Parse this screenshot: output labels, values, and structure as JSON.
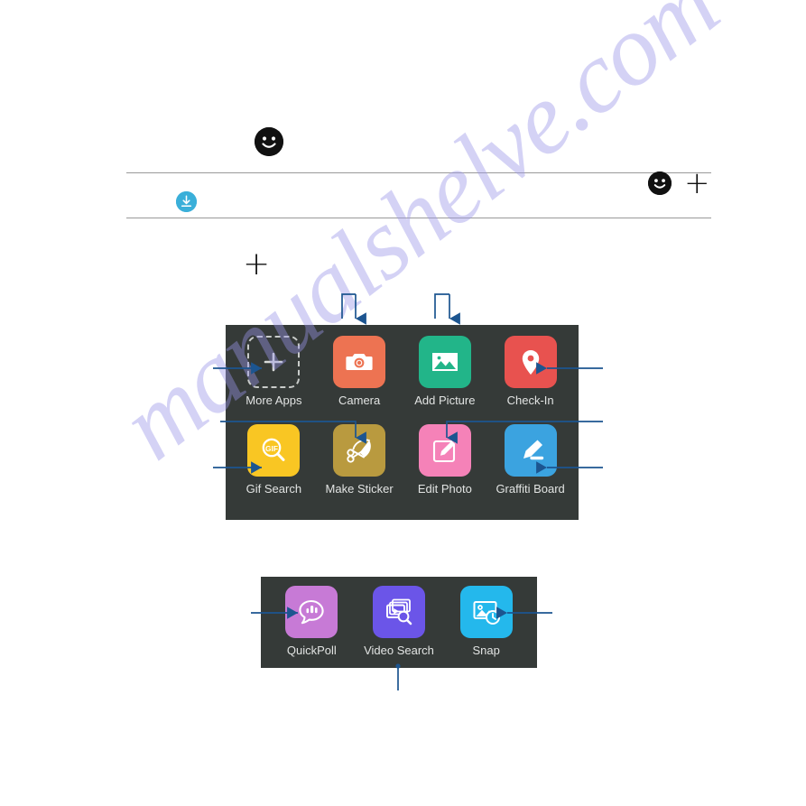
{
  "document": {
    "watermark": "manualshelve.com"
  },
  "toolbar": {
    "compose_smiley_icon": "smiley-icon",
    "emoji_icon": "smiley-icon",
    "add_icon": "plus-icon",
    "attach_icon": "plus-icon",
    "download_icon": "download-icon"
  },
  "panels": [
    {
      "name": "main-app-panel",
      "apps": [
        {
          "label": "More Apps",
          "icon": "plus-dashed-icon",
          "color": "#353a38"
        },
        {
          "label": "Camera",
          "icon": "camera-icon",
          "color": "#ed7352"
        },
        {
          "label": "Add Picture",
          "icon": "image-icon",
          "color": "#22b589"
        },
        {
          "label": "Check-In",
          "icon": "map-pin-icon",
          "color": "#e8524f"
        },
        {
          "label": "Gif Search",
          "icon": "gif-search-icon",
          "color": "#f9c623"
        },
        {
          "label": "Make Sticker",
          "icon": "scissors-icon",
          "color": "#b99a3f"
        },
        {
          "label": "Edit Photo",
          "icon": "pencil-box-icon",
          "color": "#f582b8"
        },
        {
          "label": "Graffiti Board",
          "icon": "marker-pen-icon",
          "color": "#3ba3e0"
        }
      ]
    },
    {
      "name": "secondary-app-panel",
      "apps": [
        {
          "label": "QuickPoll",
          "icon": "poll-bubble-icon",
          "color": "#c77ad6"
        },
        {
          "label": "Video Search",
          "icon": "video-search-icon",
          "color": "#6b55e8"
        },
        {
          "label": "Snap",
          "icon": "photo-clock-icon",
          "color": "#24b8ec"
        }
      ]
    }
  ],
  "callouts": {
    "line_color": "#1c5590",
    "targets": [
      "camera",
      "add-picture",
      "more-apps",
      "check-in",
      "make-sticker",
      "edit-photo",
      "gif-search",
      "graffiti-board",
      "quickpoll",
      "snap",
      "video-search"
    ]
  }
}
